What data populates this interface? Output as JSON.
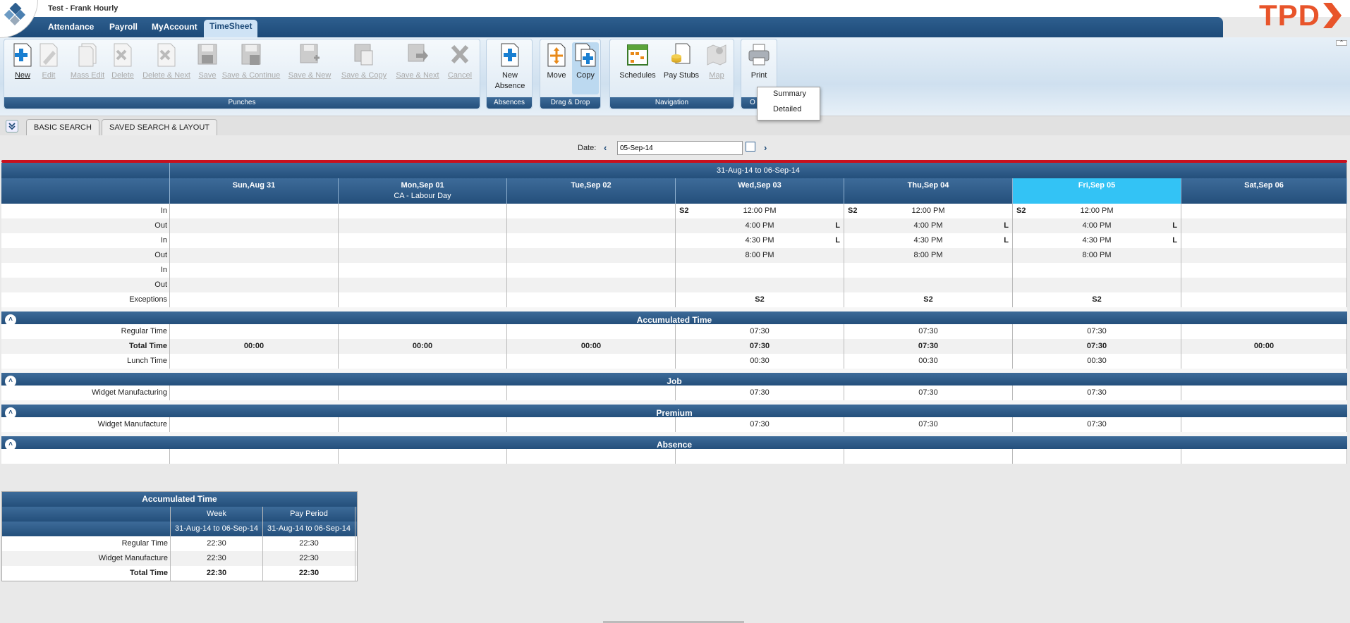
{
  "app": {
    "title": "Test - Frank Hourly",
    "brand": "TPD"
  },
  "nav": {
    "tabs": [
      "Attendance",
      "Payroll",
      "MyAccount",
      "TimeSheet"
    ],
    "active": "TimeSheet"
  },
  "toolbar": {
    "groups": [
      "Punches",
      "Absences",
      "Drag & Drop",
      "Navigation",
      "Options"
    ],
    "punches": [
      "New",
      "Edit",
      "Mass Edit",
      "Delete",
      "Delete & Next",
      "Save",
      "Save & Continue",
      "Save & New",
      "Save & Copy",
      "Save & Next",
      "Cancel"
    ],
    "new_absence": "New Absence",
    "move": "Move",
    "copy": "Copy",
    "schedules": "Schedules",
    "pay_stubs": "Pay Stubs",
    "map": "Map",
    "print": "Print",
    "options_label": "O"
  },
  "print_menu": {
    "items": [
      "Summary",
      "Detailed"
    ]
  },
  "search": {
    "tabs": [
      "BASIC SEARCH",
      "SAVED SEARCH & LAYOUT"
    ]
  },
  "date": {
    "label": "Date:",
    "value": "05-Sep-14"
  },
  "grid": {
    "range": "31-Aug-14 to 06-Sep-14",
    "days": [
      {
        "name": "Sun,Aug 31",
        "note": ""
      },
      {
        "name": "Mon,Sep 01",
        "note": "CA - Labour Day"
      },
      {
        "name": "Tue,Sep 02",
        "note": ""
      },
      {
        "name": "Wed,Sep 03",
        "note": ""
      },
      {
        "name": "Thu,Sep 04",
        "note": ""
      },
      {
        "name": "Fri,Sep 05",
        "note": ""
      },
      {
        "name": "Sat,Sep 06",
        "note": ""
      }
    ],
    "punch_rows": [
      {
        "label": "In",
        "cells": [
          "",
          "",
          "",
          "12:00 PM",
          "12:00 PM",
          "12:00 PM",
          ""
        ],
        "left": [
          "",
          "",
          "",
          "S2",
          "S2",
          "S2",
          ""
        ],
        "right": [
          "",
          "",
          "",
          "",
          "",
          "",
          ""
        ]
      },
      {
        "label": "Out",
        "cells": [
          "",
          "",
          "",
          "4:00 PM",
          "4:00 PM",
          "4:00 PM",
          ""
        ],
        "left": [
          "",
          "",
          "",
          "",
          "",
          "",
          ""
        ],
        "right": [
          "",
          "",
          "",
          "L",
          "L",
          "L",
          ""
        ]
      },
      {
        "label": "In",
        "cells": [
          "",
          "",
          "",
          "4:30 PM",
          "4:30 PM",
          "4:30 PM",
          ""
        ],
        "left": [
          "",
          "",
          "",
          "",
          "",
          "",
          ""
        ],
        "right": [
          "",
          "",
          "",
          "L",
          "L",
          "L",
          ""
        ]
      },
      {
        "label": "Out",
        "cells": [
          "",
          "",
          "",
          "8:00 PM",
          "8:00 PM",
          "8:00 PM",
          ""
        ],
        "left": [
          "",
          "",
          "",
          "",
          "",
          "",
          ""
        ],
        "right": [
          "",
          "",
          "",
          "",
          "",
          "",
          ""
        ]
      },
      {
        "label": "In",
        "cells": [
          "",
          "",
          "",
          "",
          "",
          "",
          ""
        ],
        "left": [
          "",
          "",
          "",
          "",
          "",
          "",
          ""
        ],
        "right": [
          "",
          "",
          "",
          "",
          "",
          "",
          ""
        ]
      },
      {
        "label": "Out",
        "cells": [
          "",
          "",
          "",
          "",
          "",
          "",
          ""
        ],
        "left": [
          "",
          "",
          "",
          "",
          "",
          "",
          ""
        ],
        "right": [
          "",
          "",
          "",
          "",
          "",
          "",
          ""
        ]
      },
      {
        "label": "Exceptions",
        "cells": [
          "",
          "",
          "",
          "S2",
          "S2",
          "S2",
          ""
        ],
        "left": [
          "",
          "",
          "",
          "",
          "",
          "",
          ""
        ],
        "right": [
          "",
          "",
          "",
          "",
          "",
          "",
          ""
        ],
        "bold_cells": true
      }
    ],
    "sections": {
      "accumulated": {
        "title": "Accumulated Time",
        "rows": [
          {
            "label": "Regular Time",
            "cells": [
              "",
              "",
              "",
              "07:30",
              "07:30",
              "07:30",
              ""
            ]
          },
          {
            "label": "Total Time",
            "cells": [
              "00:00",
              "00:00",
              "00:00",
              "07:30",
              "07:30",
              "07:30",
              "00:00"
            ],
            "bold": true
          },
          {
            "label": "Lunch Time",
            "cells": [
              "",
              "",
              "",
              "00:30",
              "00:30",
              "00:30",
              ""
            ]
          }
        ]
      },
      "job": {
        "title": "Job",
        "rows": [
          {
            "label": "Widget Manufacturing",
            "cells": [
              "",
              "",
              "",
              "07:30",
              "07:30",
              "07:30",
              ""
            ]
          }
        ]
      },
      "premium": {
        "title": "Premium",
        "rows": [
          {
            "label": "Widget Manufacture",
            "cells": [
              "",
              "",
              "",
              "07:30",
              "07:30",
              "07:30",
              ""
            ]
          }
        ]
      },
      "absence": {
        "title": "Absence",
        "rows": [
          {
            "label": "",
            "cells": [
              "",
              "",
              "",
              "",
              "",
              "",
              ""
            ]
          }
        ]
      }
    }
  },
  "summary": {
    "title": "Accumulated Time",
    "col_week": "Week",
    "col_pay": "Pay Period",
    "week_range": "31-Aug-14 to 06-Sep-14",
    "pay_range": "31-Aug-14 to 06-Sep-14",
    "rows": [
      {
        "label": "Regular Time",
        "week": "22:30",
        "pay": "22:30"
      },
      {
        "label": "Widget Manufacture",
        "week": "22:30",
        "pay": "22:30"
      },
      {
        "label": "Total Time",
        "week": "22:30",
        "pay": "22:30",
        "bold": true
      }
    ]
  },
  "colors": {
    "header_blue": "#244f7b",
    "today": "#33c3f5",
    "brand_orange": "#e8542a",
    "accent_red": "#c8101e"
  }
}
